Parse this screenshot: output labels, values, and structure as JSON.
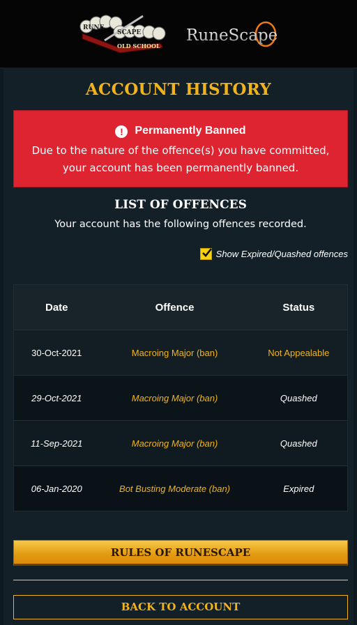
{
  "header": {
    "osrs_logo": {
      "line1": "RUNE",
      "line2": "SCAPE",
      "banner": "OLD SCHOOL"
    },
    "rs_logo": "RuneScape"
  },
  "page_title": "ACCOUNT HISTORY",
  "ban_notice": {
    "heading": "Permanently Banned",
    "text_line1": "Due to the nature of the offence(s) you have committed,",
    "text_line2": "your account has been permanently banned.",
    "color": "#de2431"
  },
  "offences": {
    "title": "LIST OF OFFENCES",
    "subtitle": "Your account has the following offences recorded.",
    "toggle_label": "Show Expired/Quashed offences",
    "toggle_checked": true
  },
  "table": {
    "headers": {
      "date": "Date",
      "offence": "Offence",
      "status": "Status"
    },
    "rows": [
      {
        "date": "30-Oct-2021",
        "offence": "Macroing Major (ban)",
        "status": "Not Appealable"
      },
      {
        "date": "29-Oct-2021",
        "offence": "Macroing Major (ban)",
        "status": "Quashed"
      },
      {
        "date": "11-Sep-2021",
        "offence": "Macroing Major (ban)",
        "status": "Quashed"
      },
      {
        "date": "06-Jan-2020",
        "offence": "Bot Busting Moderate (ban)",
        "status": "Expired"
      }
    ]
  },
  "buttons": {
    "rules": "RULES OF RUNESCAPE",
    "back": "BACK TO ACCOUNT"
  },
  "colors": {
    "accent_gold": "#f0b31e",
    "background": "#142028",
    "header_bg": "#050505"
  }
}
